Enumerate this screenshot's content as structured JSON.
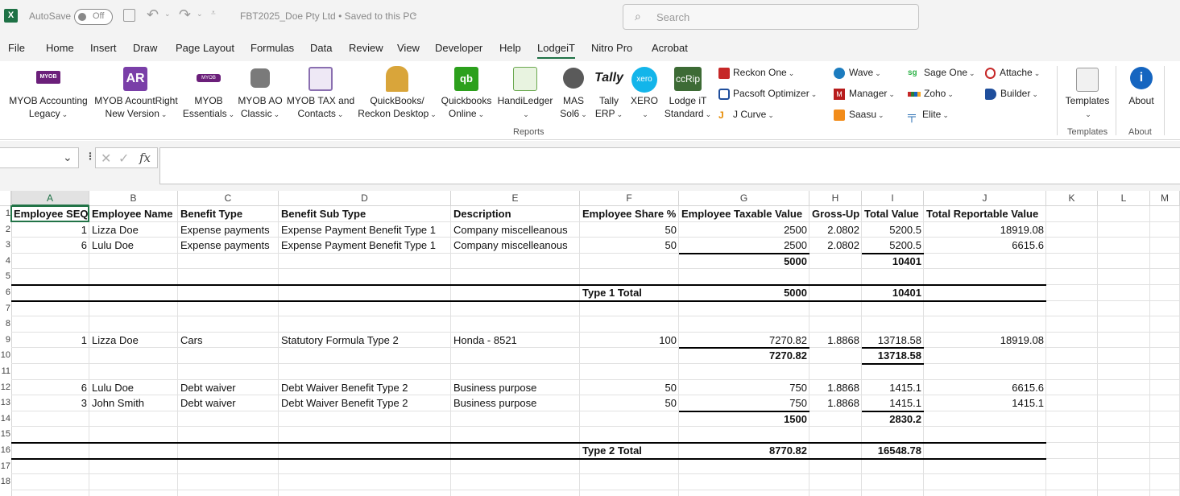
{
  "titlebar": {
    "autosave_label": "AutoSave",
    "autosave_state": "Off",
    "document_title": "FBT2025_Doe Pty Ltd  •  Saved to this PC",
    "search_placeholder": "Search"
  },
  "tabs": [
    "File",
    "Home",
    "Insert",
    "Draw",
    "Page Layout",
    "Formulas",
    "Data",
    "Review",
    "View",
    "Developer",
    "Help",
    "LodgeiT",
    "Nitro Pro",
    "Acrobat"
  ],
  "active_tab": "LodgeiT",
  "ribbon": {
    "large_buttons": [
      {
        "line1": "MYOB Accounting",
        "line2": "Legacy",
        "icon": "myob-icon",
        "color": "#6b1f7a"
      },
      {
        "line1": "MYOB AcountRight",
        "line2": "New Version",
        "icon": "ar-icon",
        "color": "#7a3fa8"
      },
      {
        "line1": "MYOB",
        "line2": "Essentials",
        "icon": "myob-essentials-icon",
        "color": "#6b1f7a"
      },
      {
        "line1": "MYOB AO",
        "line2": "Classic",
        "icon": "myob-ao-icon",
        "color": "#7a7a7a"
      },
      {
        "line1": "MYOB TAX and",
        "line2": "Contacts",
        "icon": "myob-tax-icon",
        "color": "#8a6fb0"
      },
      {
        "line1": "QuickBooks/",
        "line2": "Reckon Desktop",
        "icon": "quickbooks-desktop-icon",
        "color": "#b8862b"
      },
      {
        "line1": "Quickbooks",
        "line2": "Online",
        "icon": "quickbooks-online-icon",
        "color": "#2ca01c"
      },
      {
        "line1": "HandiLedger",
        "line2": "",
        "icon": "handiledger-icon",
        "color": "#6aa84f"
      },
      {
        "line1": "MAS",
        "line2": "Sol6",
        "icon": "mas-icon",
        "color": "#4a4a4a"
      },
      {
        "line1": "Tally",
        "line2": "ERP",
        "icon": "tally-icon",
        "color": "#1a1a1a"
      },
      {
        "line1": "XERO",
        "line2": "",
        "icon": "xero-icon",
        "color": "#13b5ea"
      },
      {
        "line1": "Lodge iT",
        "line2": "Standard",
        "icon": "lodgeit-icon",
        "color": "#3d6b35"
      }
    ],
    "small_buttons": {
      "col1": [
        {
          "label": "Reckon One",
          "icon": "reckon-icon",
          "color": "#c62828"
        },
        {
          "label": "Pacsoft Optimizer",
          "icon": "pacsoft-icon",
          "color": "#1f4e9c"
        },
        {
          "label": "J Curve",
          "icon": "jcurve-icon",
          "color": "#e68a00"
        }
      ],
      "col2": [
        {
          "label": "Wave",
          "icon": "wave-icon",
          "color": "#1c7cbf"
        },
        {
          "label": "Manager",
          "icon": "manager-icon",
          "color": "#b71c1c"
        },
        {
          "label": "Saasu",
          "icon": "saasu-icon",
          "color": "#f28c1a"
        }
      ],
      "col3": [
        {
          "label": "Sage One",
          "icon": "sage-icon",
          "color": "#30b34a"
        },
        {
          "label": "Zoho",
          "icon": "zoho-icon",
          "color": "#c62828"
        },
        {
          "label": "Elite",
          "icon": "elite-icon",
          "color": "#2a6fb3"
        }
      ],
      "col4": [
        {
          "label": "Attache",
          "icon": "attache-icon",
          "color": "#c62828"
        },
        {
          "label": "Builder",
          "icon": "builder-icon",
          "color": "#1f4e9c"
        }
      ]
    },
    "reports_group_label": "Reports",
    "templates_button": "Templates",
    "templates_group_label": "Templates",
    "about_button": "About",
    "about_group_label": "About"
  },
  "formula_bar": {
    "name_box": "",
    "fx_label": "fx",
    "formula": ""
  },
  "columns": [
    "A",
    "B",
    "C",
    "D",
    "E",
    "F",
    "G",
    "H",
    "I",
    "J",
    "K",
    "L",
    "M"
  ],
  "rows": [
    {
      "n": "1",
      "cells": [
        "Employee SEQ",
        "Employee Name",
        "Benefit Type",
        "Benefit Sub Type",
        "Description",
        "Employee Share %",
        "Employee Taxable Value",
        "Gross-Up",
        "Total Value",
        "Total Reportable Value"
      ]
    },
    {
      "n": "2",
      "cells": [
        "1",
        "Lizza Doe",
        "Expense payments",
        "Expense Payment Benefit Type 1",
        "Company miscelleanous",
        "50",
        "2500",
        "2.0802",
        "5200.5",
        "18919.08"
      ]
    },
    {
      "n": "3",
      "cells": [
        "6",
        "Lulu Doe",
        "Expense payments",
        "Expense Payment Benefit Type 1",
        "Company miscelleanous",
        "50",
        "2500",
        "2.0802",
        "5200.5",
        "6615.6"
      ]
    },
    {
      "n": "4",
      "cells": [
        "",
        "",
        "",
        "",
        "",
        "",
        "5000",
        "",
        "10401",
        ""
      ]
    },
    {
      "n": "5",
      "cells": [
        "",
        "",
        "",
        "",
        "",
        "",
        "",
        "",
        "",
        ""
      ]
    },
    {
      "n": "6",
      "cells": [
        "",
        "",
        "",
        "",
        "",
        "Type 1 Total",
        "5000",
        "",
        "10401",
        ""
      ]
    },
    {
      "n": "7",
      "cells": [
        "",
        "",
        "",
        "",
        "",
        "",
        "",
        "",
        "",
        ""
      ]
    },
    {
      "n": "8",
      "cells": [
        "",
        "",
        "",
        "",
        "",
        "",
        "",
        "",
        "",
        ""
      ]
    },
    {
      "n": "9",
      "cells": [
        "1",
        "Lizza Doe",
        "Cars",
        "Statutory Formula Type 2",
        "Honda - 8521",
        "100",
        "7270.82",
        "1.8868",
        "13718.58",
        "18919.08"
      ]
    },
    {
      "n": "10",
      "cells": [
        "",
        "",
        "",
        "",
        "",
        "",
        "7270.82",
        "",
        "13718.58",
        ""
      ]
    },
    {
      "n": "11",
      "cells": [
        "",
        "",
        "",
        "",
        "",
        "",
        "",
        "",
        "",
        ""
      ]
    },
    {
      "n": "12",
      "cells": [
        "6",
        "Lulu Doe",
        "Debt waiver",
        "Debt Waiver Benefit Type 2",
        "Business purpose",
        "50",
        "750",
        "1.8868",
        "1415.1",
        "6615.6"
      ]
    },
    {
      "n": "13",
      "cells": [
        "3",
        "John  Smith",
        "Debt waiver",
        "Debt Waiver Benefit Type 2",
        "Business purpose",
        "50",
        "750",
        "1.8868",
        "1415.1",
        "1415.1"
      ]
    },
    {
      "n": "14",
      "cells": [
        "",
        "",
        "",
        "",
        "",
        "",
        "1500",
        "",
        "2830.2",
        ""
      ]
    },
    {
      "n": "15",
      "cells": [
        "",
        "",
        "",
        "",
        "",
        "",
        "",
        "",
        "",
        ""
      ]
    },
    {
      "n": "16",
      "cells": [
        "",
        "",
        "",
        "",
        "",
        "Type 2 Total",
        "8770.82",
        "",
        "16548.78",
        ""
      ]
    },
    {
      "n": "17",
      "cells": [
        "",
        "",
        "",
        "",
        "",
        "",
        "",
        "",
        "",
        ""
      ]
    },
    {
      "n": "18",
      "cells": [
        "",
        "",
        "",
        "",
        "",
        "",
        "",
        "",
        "",
        ""
      ]
    }
  ],
  "colors": {
    "excel_green": "#1e7145",
    "selected_cell_border": "#217346"
  }
}
